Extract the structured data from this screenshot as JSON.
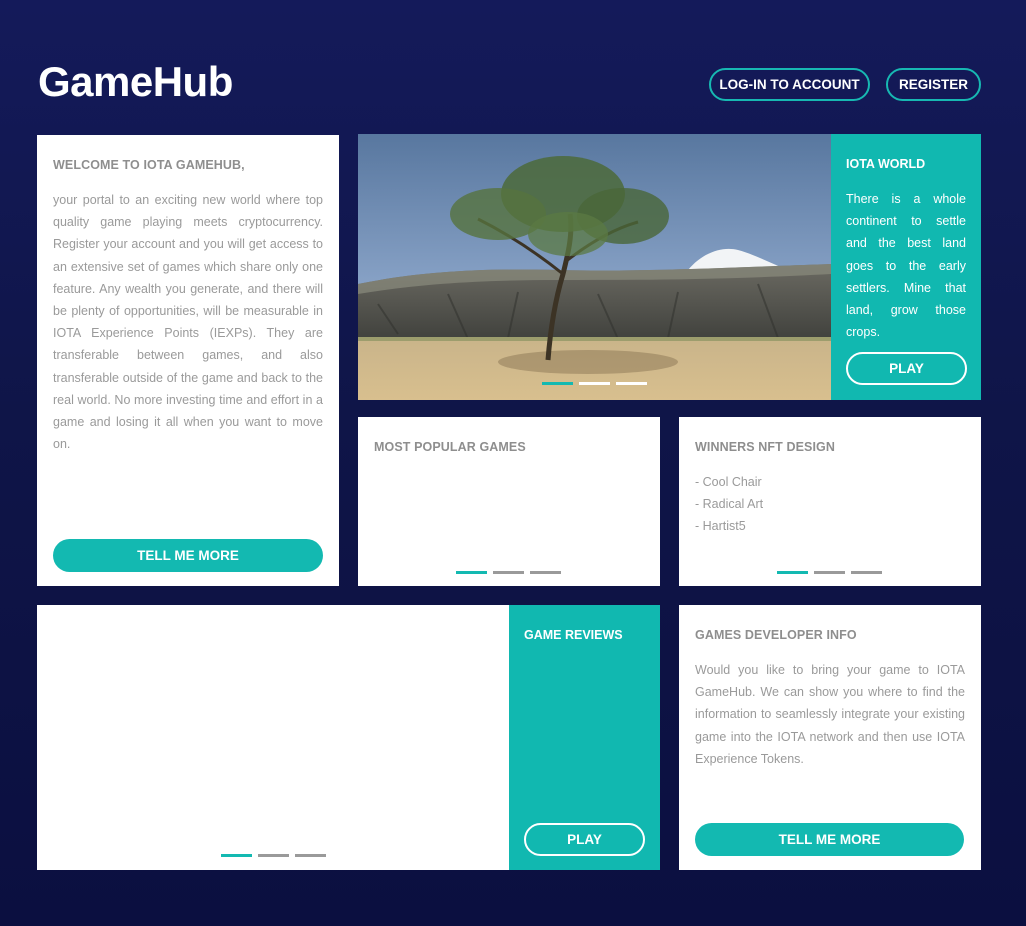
{
  "header": {
    "logo": "GameHub",
    "login_label": "LOG-IN TO ACCOUNT",
    "register_label": "REGISTER"
  },
  "welcome": {
    "title": "WELCOME TO IOTA GAMEHUB,",
    "text": "your portal to an exciting new world where top quality game playing meets cryptocurrency. Register your account and you will get access to an extensive set of games which share only one feature. Any wealth you generate, and there will be plenty of opportunities, will be measurable in IOTA Experience Points (IEXPs). They are transferable between games, and also transferable outside of the game and back to the real world. No more investing time and effort in a game and losing it all when you want to move on.",
    "button_label": "TELL ME MORE"
  },
  "hero": {
    "image_icon": "landscape-tree-illustration",
    "side_title": "IOTA WORLD",
    "side_text": "There is a whole continent to settle and the best land goes to the early settlers. Mine that land, grow those crops.",
    "play_label": "PLAY",
    "slides": 3,
    "active_slide": 1
  },
  "popular": {
    "title": "MOST POPULAR GAMES",
    "slides": 3,
    "active_slide": 1
  },
  "winners": {
    "title": "WINNERS NFT DESIGN",
    "items": [
      "- Cool Chair",
      "- Radical Art",
      "- Hartist5"
    ],
    "slides": 3,
    "active_slide": 1
  },
  "reviews": {
    "side_title": "GAME REVIEWS",
    "play_label": "PLAY",
    "slides": 3,
    "active_slide": 1
  },
  "devinfo": {
    "title": "GAMES DEVELOPER INFO",
    "text": "Would you like to bring your game to IOTA GameHub.  We can show you where to find the information to seamlessly integrate your existing game into the IOTA network and then use IOTA Experience Tokens.",
    "button_label": "TELL ME MORE"
  },
  "colors": {
    "background": "#10164c",
    "accent": "#13b9b1",
    "card": "#ffffff",
    "muted_text": "#9a9a9a"
  }
}
